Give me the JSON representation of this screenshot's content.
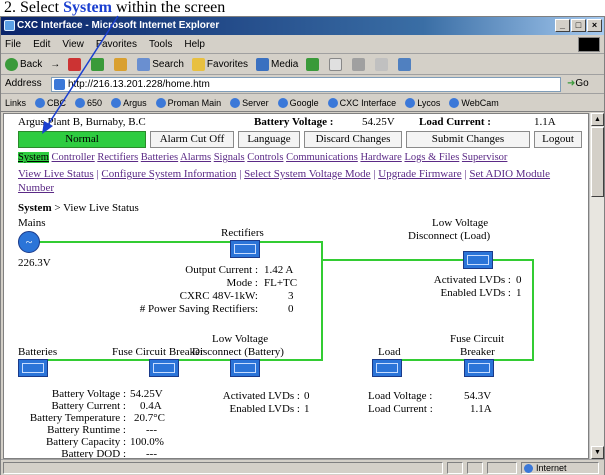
{
  "caption": {
    "prefix": "2.   Select ",
    "keyword": "System",
    "suffix": " within the screen"
  },
  "window": {
    "title": "CXC Interface - Microsoft Internet Explorer",
    "buttons": [
      "_",
      "□",
      "×"
    ],
    "menu": [
      "File",
      "Edit",
      "View",
      "Favorites",
      "Tools",
      "Help"
    ],
    "toolbar": [
      "Back",
      "Search",
      "Favorites",
      "Media"
    ],
    "address_label": "Address",
    "address_value": "http://216.13.201.228/home.htm",
    "go_label": "Go",
    "links_label": "Links",
    "links": [
      "CBC",
      "650",
      "Argus",
      "Proman Main",
      "Server",
      "Google",
      "CXC Interface",
      "Lycos",
      "WebCam"
    ],
    "status_zone": "Internet"
  },
  "page": {
    "site": "Argus Plant B, Burnaby, B.C",
    "battery_voltage_label": "Battery Voltage :",
    "battery_voltage_value": "54.25V",
    "load_current_label": "Load Current :",
    "load_current_value": "1.1A",
    "status": "Normal",
    "buttons": [
      "Alarm Cut Off",
      "Language",
      "Discard Changes",
      "Submit Changes",
      "Logout"
    ],
    "nav": [
      "System",
      "Controller",
      "Rectifiers",
      "Batteries",
      "Alarms",
      "Signals",
      "Controls",
      "Communications",
      "Hardware",
      "Logs & Files",
      "Supervisor"
    ],
    "sublinks": [
      "View Live Status",
      "Configure System Information",
      "Select System Voltage Mode",
      "Upgrade Firmware",
      "Set ADIO Module",
      "Number"
    ],
    "breadcrumb_bold": "System",
    "breadcrumb_rest": " > View Live Status",
    "mains": {
      "label": "Mains",
      "voltage": "226.3V"
    },
    "rectifiers": {
      "label": "Rectifiers",
      "rows": [
        {
          "label": "Output Current :",
          "value": "1.42   A"
        },
        {
          "label": "Mode :",
          "value": "FL+TC"
        },
        {
          "label": "CXRC 48V-1kW:",
          "value": "3"
        },
        {
          "label": "# Power Saving Rectifiers:",
          "value": "0"
        }
      ]
    },
    "lvd_load": {
      "label1": "Low Voltage",
      "label2": "Disconnect (Load)",
      "rows": [
        {
          "label": "Activated LVDs :",
          "value": "0"
        },
        {
          "label": "Enabled LVDs :",
          "value": "1"
        }
      ]
    },
    "batteries": {
      "label": "Batteries",
      "rows": [
        {
          "label": "Battery Voltage :",
          "value": "54.25V"
        },
        {
          "label": "Battery Current :",
          "value": "0.4A"
        },
        {
          "label": "Battery Temperature :",
          "value": "20.7°C"
        },
        {
          "label": "Battery Runtime :",
          "value": "---"
        },
        {
          "label": "Battery Capacity :",
          "value": "100.0%"
        },
        {
          "label": "Battery DOD :",
          "value": "---"
        }
      ]
    },
    "fcb_battery": {
      "label": "Fuse Circuit Breaker"
    },
    "lvd_battery": {
      "label1": "Low Voltage",
      "label2": "Disconnect (Battery)",
      "rows": [
        {
          "label": "Activated LVDs :",
          "value": "0"
        },
        {
          "label": "Enabled LVDs :",
          "value": "1"
        }
      ]
    },
    "load": {
      "label": "Load",
      "rows": [
        {
          "label": "Load Voltage :",
          "value": "54.3V"
        },
        {
          "label": "Load Current :",
          "value": "1.1A"
        }
      ]
    },
    "fcb_load": {
      "label1": "Fuse Circuit",
      "label2": "Breaker"
    }
  },
  "colors": {
    "accent_green": "#2ecc40",
    "wire_green": "#33cc33",
    "component_blue": "#2b74d8",
    "link_purple": "#5b2a86"
  }
}
